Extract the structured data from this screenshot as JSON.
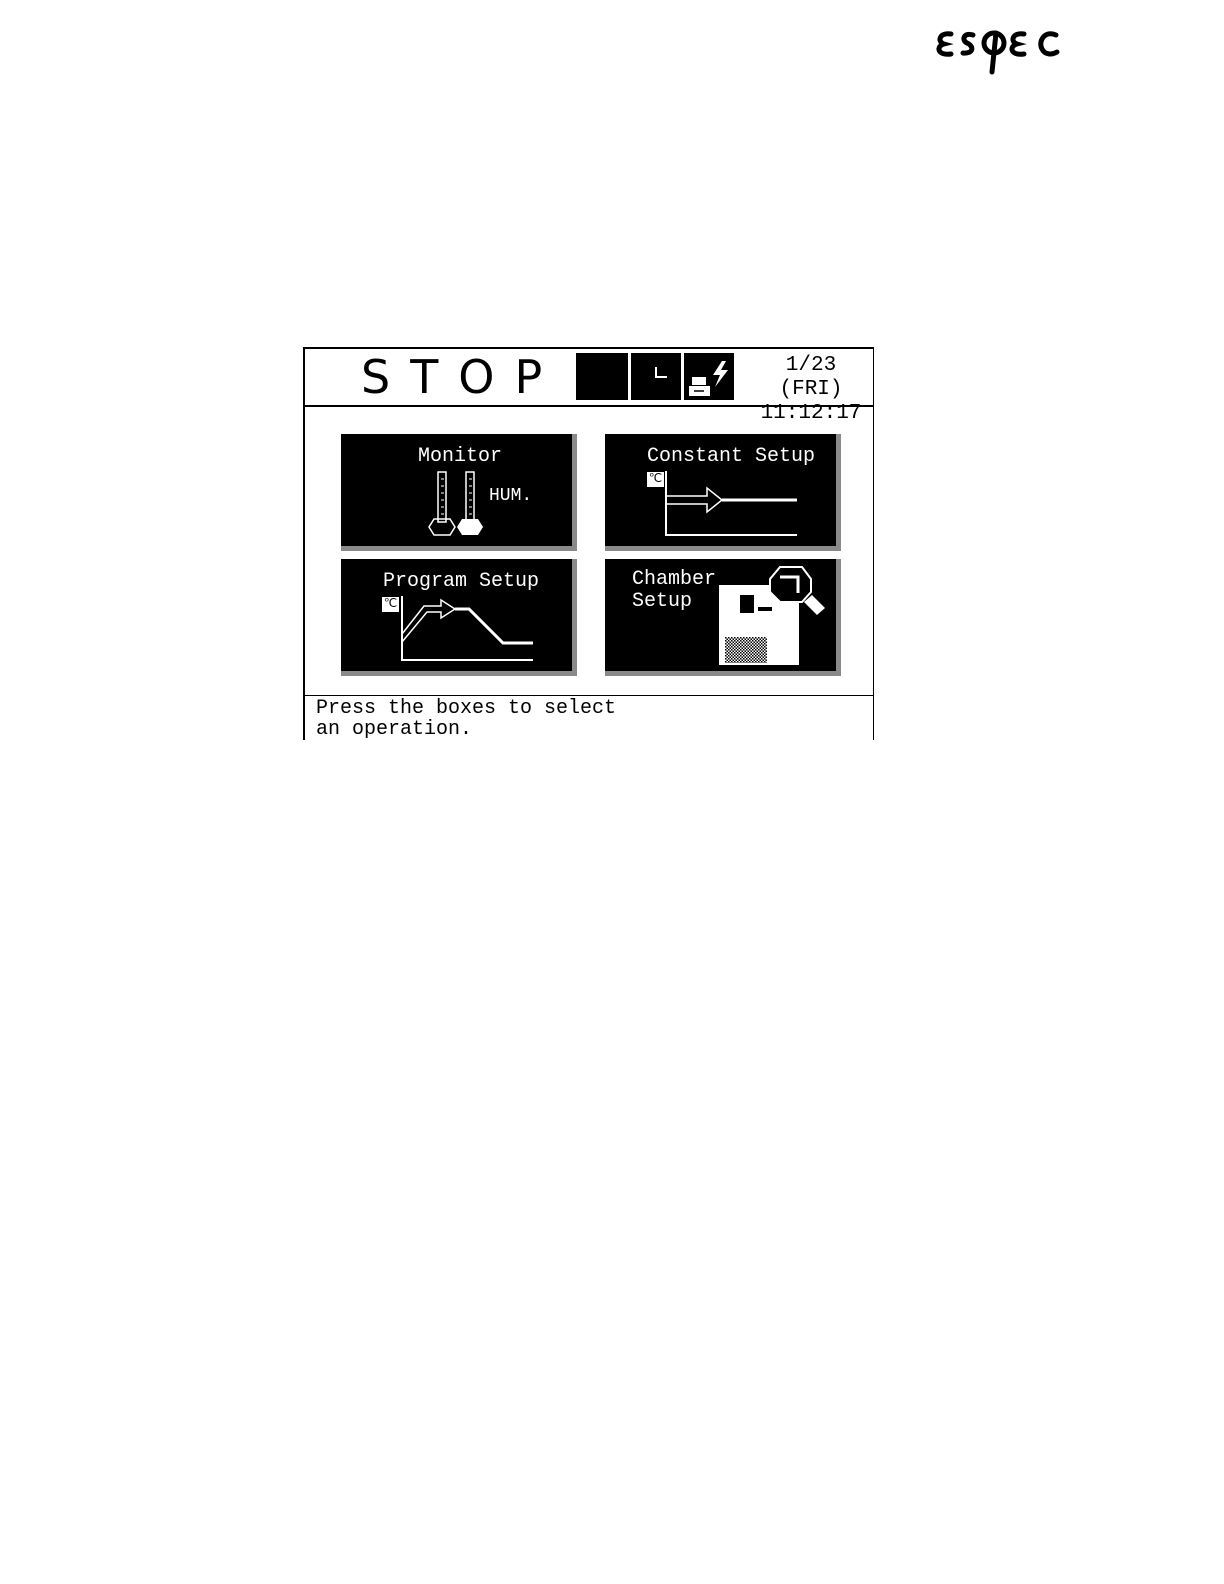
{
  "brand": {
    "logo_text": "espec"
  },
  "header": {
    "status": "STOP",
    "date": "1/23 (FRI)",
    "time": "11:12:17",
    "indicators": [
      {
        "icon": "blank-indicator"
      },
      {
        "icon": "l-indicator",
        "text": "L"
      },
      {
        "icon": "printer-power-icon"
      }
    ]
  },
  "menu": {
    "monitor": {
      "label": "Monitor",
      "sublabel": "HUM."
    },
    "constant_setup": {
      "label": "Constant Setup",
      "unit": "℃"
    },
    "program_setup": {
      "label": "Program Setup",
      "unit": "℃"
    },
    "chamber_setup": {
      "label": "Chamber\nSetup"
    }
  },
  "footer": {
    "message": "Press the boxes to select an operation."
  }
}
